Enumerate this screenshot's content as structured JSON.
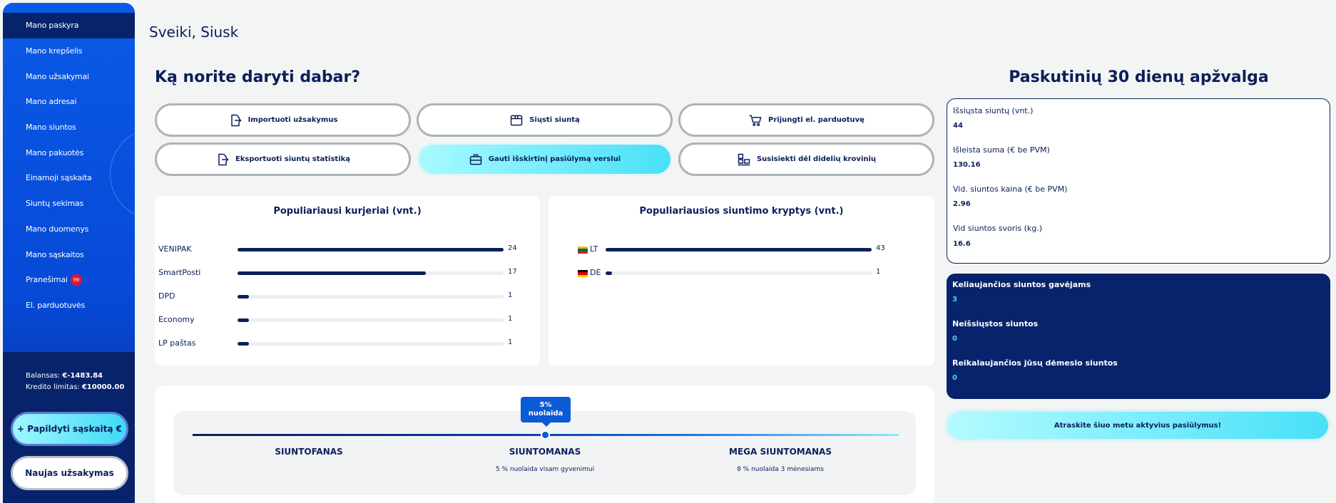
{
  "sidebar": {
    "items": [
      {
        "label": "Mano paskyra"
      },
      {
        "label": "Mano krepšelis"
      },
      {
        "label": "Mano užsakymai"
      },
      {
        "label": "Mano adresai"
      },
      {
        "label": "Mano siuntos"
      },
      {
        "label": "Mano pakuotės"
      },
      {
        "label": "Einamoji sąskaita"
      },
      {
        "label": "Siuntų sekimas"
      },
      {
        "label": "Mano duomenys"
      },
      {
        "label": "Mano sąskaitos"
      },
      {
        "label": "Pranešimai",
        "badge": "99"
      },
      {
        "label": "El. parduotuvės"
      }
    ],
    "balance_label": "Balansas:",
    "balance_value": "€-1483.84",
    "credit_label": "Kredito limitas:",
    "credit_value": "€10000.00",
    "topup_button": "+ Papildyti sąskaitą €",
    "new_order_button": "Naujas užsakymas"
  },
  "header": {
    "greeting": "Sveiki, Siusk"
  },
  "actions": {
    "title": "Ką norite daryti dabar?",
    "buttons": [
      {
        "label": "Importuoti užsakymus",
        "icon": "import-icon"
      },
      {
        "label": "Siųsti siuntą",
        "icon": "box-icon"
      },
      {
        "label": "Prijungti el. parduotuvę",
        "icon": "cart-icon"
      },
      {
        "label": "Eksportuoti siuntų statistiką",
        "icon": "export-icon"
      },
      {
        "label": "Gauti išskirtinį pasiūlymą verslui",
        "icon": "briefcase-icon"
      },
      {
        "label": "Susisiekti dėl didelių krovinių",
        "icon": "pallet-icon"
      }
    ]
  },
  "couriers": {
    "title": "Populiariausi kurjeriai (vnt.)",
    "max": 24,
    "rows": [
      {
        "name": "VENIPAK",
        "value": 24
      },
      {
        "name": "SmartPosti",
        "value": 17
      },
      {
        "name": "DPD",
        "value": 1
      },
      {
        "name": "Economy",
        "value": 1
      },
      {
        "name": "LP paštas",
        "value": 1
      }
    ]
  },
  "directions": {
    "title": "Populiariausios siuntimo kryptys (vnt.)",
    "max": 43,
    "rows": [
      {
        "code": "LT",
        "value": 43,
        "flag": [
          "#fdb913",
          "#006a44",
          "#c1272d"
        ]
      },
      {
        "code": "DE",
        "value": 1,
        "flag": [
          "#000000",
          "#dd0000",
          "#ffce00"
        ]
      }
    ]
  },
  "loyalty": {
    "tooltip_line1": "5%",
    "tooltip_line2": "nuolaida",
    "tiers": [
      {
        "name": "SIUNTOFANAS",
        "desc": ""
      },
      {
        "name": "SIUNTOMANAS",
        "desc": "5 % nuolaida visam gyvenimui"
      },
      {
        "name": "MEGA SIUNTOMANAS",
        "desc": "8 % nuolaida 3 mėnesiams"
      }
    ]
  },
  "overview": {
    "title": "Paskutinių 30 dienų apžvalga",
    "stats": [
      {
        "label": "Išsiųsta siuntų (vnt.)",
        "value": "44"
      },
      {
        "label": "Išleista suma (€ be PVM)",
        "value": "130.16"
      },
      {
        "label": "Vid. siuntos kaina (€ be PVM)",
        "value": "2.96"
      },
      {
        "label": "Vid siuntos svoris (kg.)",
        "value": "16.6"
      }
    ],
    "status": [
      {
        "label": "Keliaujančios siuntos gavėjams",
        "value": "3"
      },
      {
        "label": "Neišsiųstos siuntos",
        "value": "0"
      },
      {
        "label": "Reikalaujančios jūsų dėmesio siuntos",
        "value": "0"
      }
    ],
    "offers_button": "Atraskite šiuo metu aktyvius pasiūlymus!"
  }
}
